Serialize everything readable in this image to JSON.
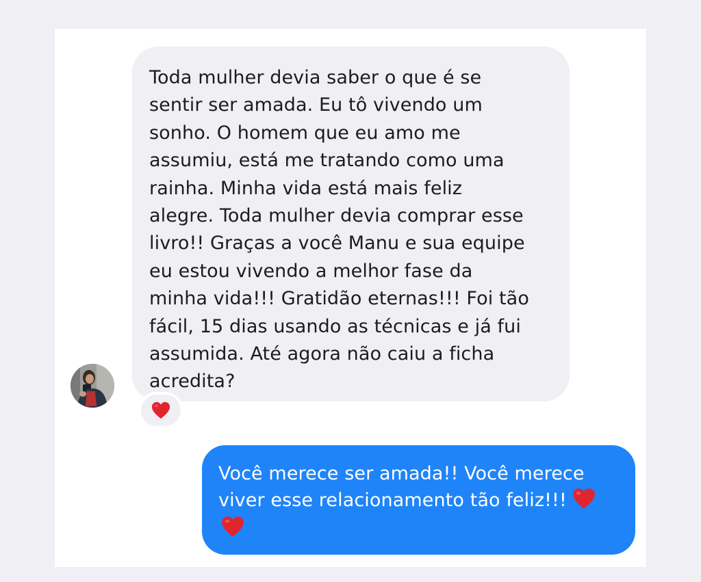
{
  "conversation": {
    "incoming_message": {
      "lines": [
        "Toda mulher devia saber o que é se",
        "sentir ser amada. Eu tô vivendo um",
        "sonho. O homem que eu amo me",
        "assumiu, está me tratando como uma",
        "rainha. Minha vida está mais feliz",
        "alegre. Toda mulher devia comprar esse",
        "livro!! Graças a você Manu e sua equipe",
        "eu estou vivendo a melhor fase da",
        "minha vida!!! Gratidão eternas!!! Foi tão",
        "fácil, 15 dias usando as técnicas e já fui",
        "assumida. Até agora não caiu a ficha",
        "acredita?"
      ],
      "reaction": "heart-icon",
      "sender_avatar": "avatar-photo",
      "bubble_color": "#efeff4",
      "text_color": "#1c1c1e"
    },
    "outgoing_message": {
      "lines": [
        "Você merece ser amada!! Você merece",
        "viver esse relacionamento tão feliz!!!"
      ],
      "emoji": "heart-icon",
      "bubble_color": "#1f84f8",
      "text_color": "#ffffff"
    },
    "heart_color": "#e0252f"
  }
}
